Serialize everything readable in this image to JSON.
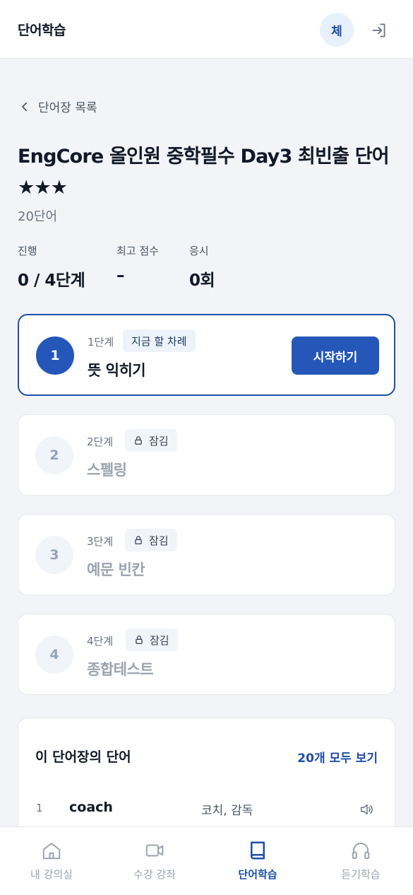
{
  "header": {
    "title": "단어학습",
    "avatar_initial": "체",
    "logout_icon": "logout-icon"
  },
  "back": {
    "label": "단어장 목록",
    "icon": "chevron-left-icon"
  },
  "wordbook": {
    "title": "EngCore 올인원 중학필수 Day3 최빈출 단어 ★★★",
    "word_count": "20단어"
  },
  "stats": [
    {
      "label": "진행",
      "value": "0 / 4단계"
    },
    {
      "label": "최고 점수",
      "value": "–"
    },
    {
      "label": "응시",
      "value": "0회"
    }
  ],
  "steps": [
    {
      "number": "1",
      "stage": "1단계",
      "badge": "지금 할 차례",
      "name": "뜻 익히기",
      "status": "current",
      "button": "시작하기"
    },
    {
      "number": "2",
      "stage": "2단계",
      "badge": "잠김",
      "name": "스펠링",
      "status": "locked"
    },
    {
      "number": "3",
      "stage": "3단계",
      "badge": "잠김",
      "name": "예문 빈칸",
      "status": "locked"
    },
    {
      "number": "4",
      "stage": "4단계",
      "badge": "잠김",
      "name": "종합테스트",
      "status": "locked"
    }
  ],
  "words_section": {
    "title": "이 단어장의 단어",
    "view_all": "20개 모두 보기",
    "words": [
      {
        "index": "1",
        "english": "coach",
        "korean": "코치, 감독"
      }
    ]
  },
  "tabbar": [
    {
      "label": "내 강의실",
      "icon": "home-icon",
      "active": false
    },
    {
      "label": "수강 강좌",
      "icon": "video-icon",
      "active": false
    },
    {
      "label": "단어학습",
      "icon": "book-icon",
      "active": true
    },
    {
      "label": "듣기학습",
      "icon": "headphones-icon",
      "active": false
    }
  ],
  "colors": {
    "accent": "#2457b8",
    "background": "#f2f4f7",
    "card": "#ffffff"
  }
}
